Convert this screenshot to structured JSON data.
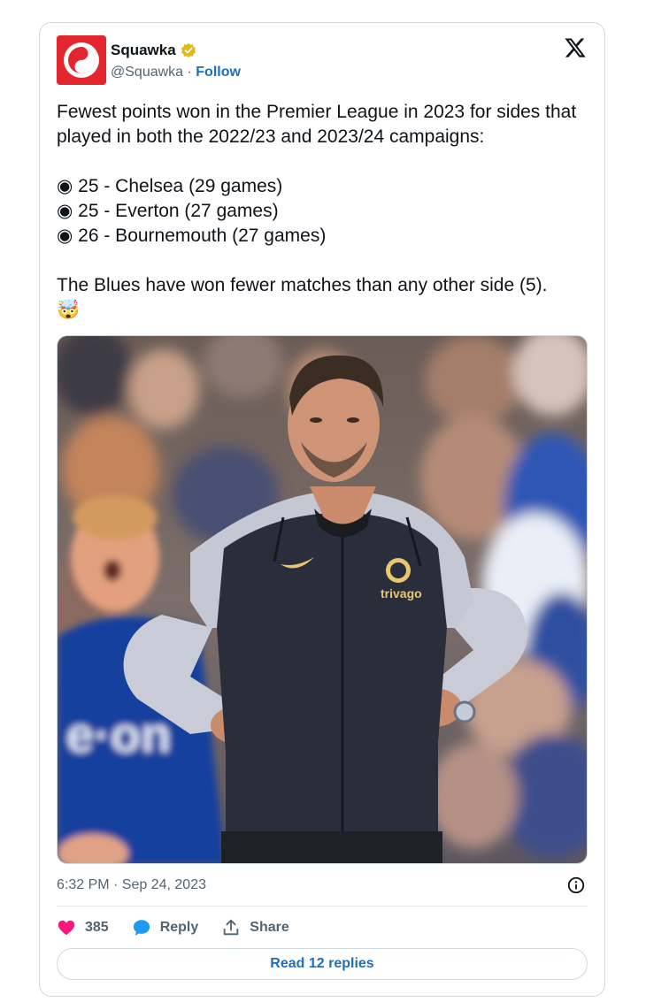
{
  "author": {
    "name": "Squawka",
    "handle": "@Squawka",
    "separator": " · ",
    "follow_label": "Follow",
    "verified_color": "#e2b719",
    "avatar_color": "#e3262e"
  },
  "tweet": {
    "paragraph1": "Fewest points won in the Premier League in 2023 for sides that played in both the 2022/23 and 2023/24 campaigns:",
    "list": [
      {
        "bullet": "◉",
        "text": " 25 - Chelsea (29 games)"
      },
      {
        "bullet": "◉",
        "text": " 25 - Everton (27 games)"
      },
      {
        "bullet": "◉",
        "text": " 26 - Bournemouth (27 games)"
      }
    ],
    "paragraph2": "The Blues have won fewer matches than any other side (5).",
    "emoji": "🤯"
  },
  "media": {
    "jacket_text": "trivago",
    "sponsor_text": "e·on"
  },
  "meta": {
    "timestamp": "6:32 PM · Sep 24, 2023"
  },
  "actions": {
    "like_count": "385",
    "reply_label": "Reply",
    "share_label": "Share",
    "like_color": "#f91880",
    "reply_color": "#1d9bf0"
  },
  "footer": {
    "read_replies_label": "Read 12 replies"
  }
}
